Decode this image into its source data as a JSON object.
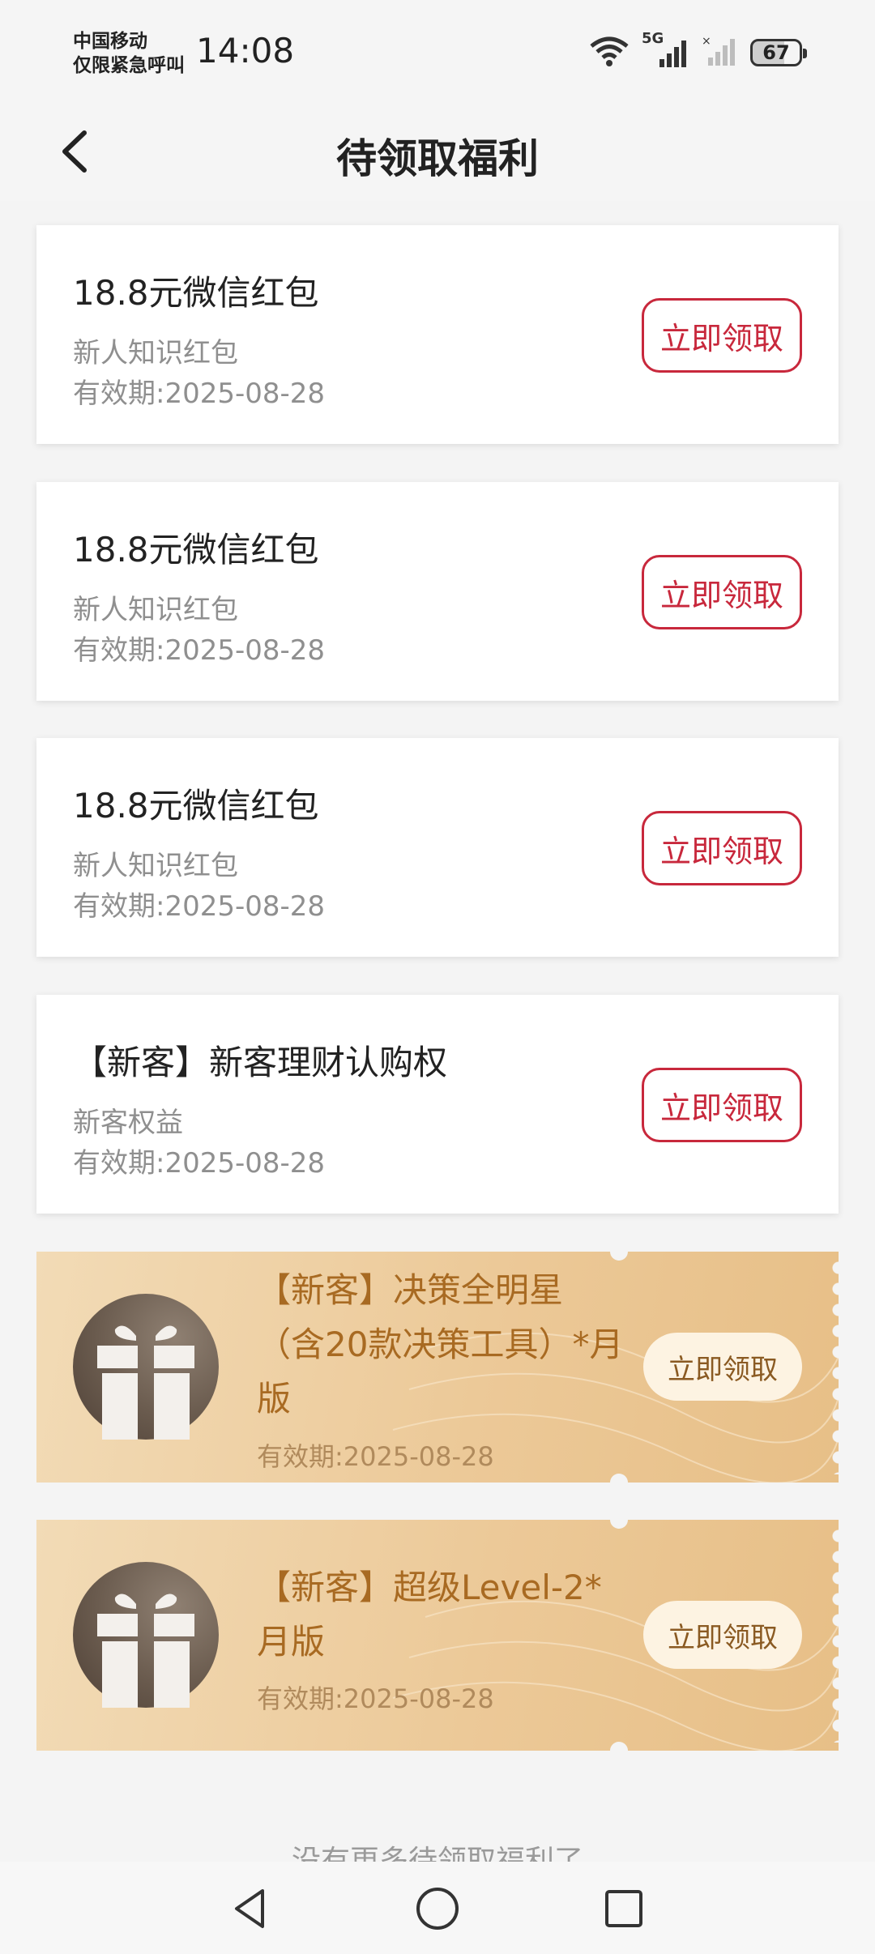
{
  "status_bar": {
    "carrier_line1": "中国移动",
    "carrier_line2": "仅限紧急呼叫",
    "time": "14:08",
    "network_label": "5G",
    "battery": "67"
  },
  "header": {
    "title": "待领取福利"
  },
  "cards": [
    {
      "name": "18.8元微信红包",
      "type": "新人知识红包",
      "expiry": "有效期:2025-08-28",
      "button": "立即领取"
    },
    {
      "name": "18.8元微信红包",
      "type": "新人知识红包",
      "expiry": "有效期:2025-08-28",
      "button": "立即领取"
    },
    {
      "name": "18.8元微信红包",
      "type": "新人知识红包",
      "expiry": "有效期:2025-08-28",
      "button": "立即领取"
    },
    {
      "name": "【新客】新客理财认购权",
      "type": "新客权益",
      "expiry": "有效期:2025-08-28",
      "button": "立即领取"
    }
  ],
  "gold_cards": [
    {
      "name": "【新客】决策全明星（含20款决策工具）*月版",
      "expiry": "有效期:2025-08-28",
      "button": "立即领取"
    },
    {
      "name": "【新客】超级Level-2*月版",
      "expiry": "有效期:2025-08-28",
      "button": "立即领取"
    }
  ],
  "footer_text": "没有更多待领取福利了",
  "colors": {
    "accent_red": "#c8283c",
    "gold_text": "#a86a22",
    "gold_bg": "#ecc998"
  },
  "icons": [
    "wifi-icon",
    "signal-icon",
    "battery-icon",
    "back-icon",
    "gift-icon",
    "nav-back-icon",
    "nav-home-icon",
    "nav-recent-icon"
  ]
}
